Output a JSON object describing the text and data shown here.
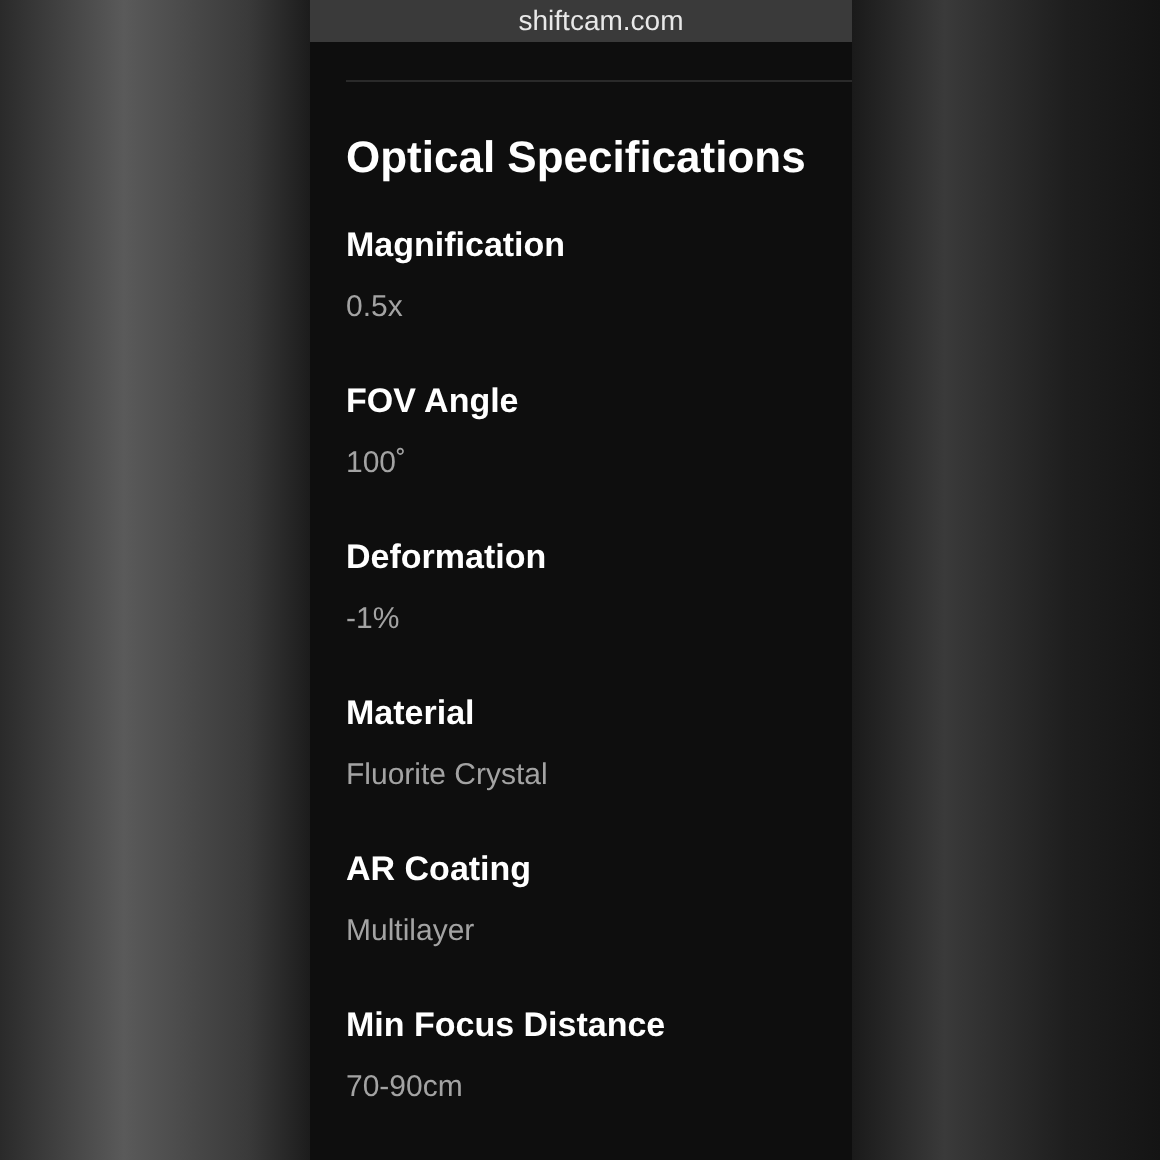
{
  "address_bar": {
    "url": "shiftcam.com"
  },
  "section": {
    "title": "Optical Specifications",
    "specs": [
      {
        "label": "Magnification",
        "value": "0.5x"
      },
      {
        "label": "FOV Angle",
        "value": "100˚"
      },
      {
        "label": "Deformation",
        "value": "-1%"
      },
      {
        "label": "Material",
        "value": "Fluorite Crystal"
      },
      {
        "label": "AR Coating",
        "value": "Multilayer"
      },
      {
        "label": "Min Focus Distance",
        "value": "70-90cm"
      }
    ]
  }
}
